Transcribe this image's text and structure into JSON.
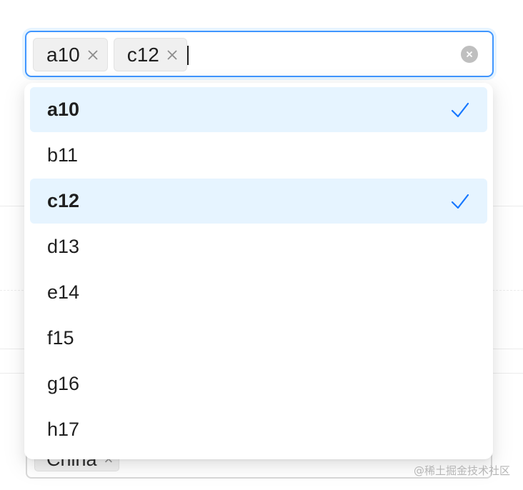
{
  "select": {
    "tags": [
      {
        "label": "a10"
      },
      {
        "label": "c12"
      }
    ]
  },
  "dropdown": {
    "options": [
      {
        "label": "a10",
        "selected": true
      },
      {
        "label": "b11",
        "selected": false
      },
      {
        "label": "c12",
        "selected": true
      },
      {
        "label": "d13",
        "selected": false
      },
      {
        "label": "e14",
        "selected": false
      },
      {
        "label": "f15",
        "selected": false
      },
      {
        "label": "g16",
        "selected": false
      },
      {
        "label": "h17",
        "selected": false
      }
    ]
  },
  "background_select": {
    "tag_label": "China"
  },
  "watermark": "@稀土掘金技术社区",
  "colors": {
    "accent": "#4096ff",
    "selected_bg": "#e6f4ff",
    "check": "#1677ff",
    "tag_bg": "#f0f0f0"
  },
  "icons": {
    "tag_close": "close-icon",
    "clear": "clear-circle-icon",
    "selected_mark": "check-icon"
  }
}
